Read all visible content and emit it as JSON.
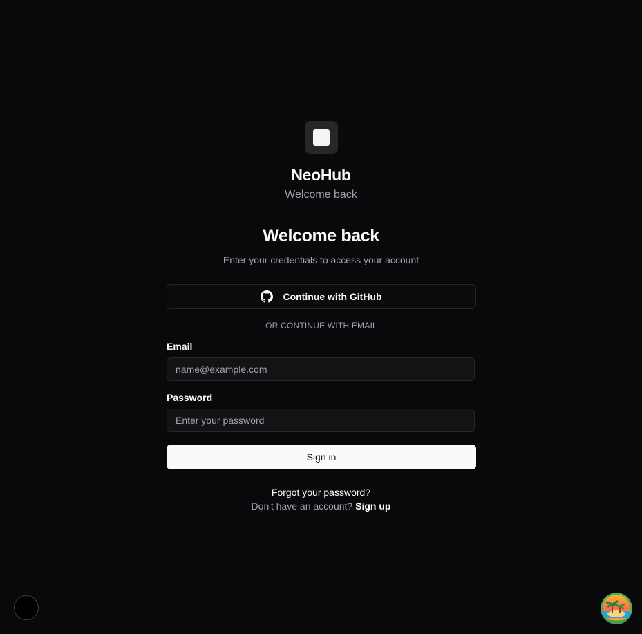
{
  "brand": {
    "name": "NeoHub",
    "tagline": "Welcome back",
    "logo_icon": "square-logo-icon"
  },
  "form": {
    "heading": "Welcome back",
    "subheading": "Enter your credentials to access your account",
    "github_button": {
      "label": "Continue with GitHub",
      "icon": "github-icon"
    },
    "divider_text": "OR CONTINUE WITH EMAIL",
    "email": {
      "label": "Email",
      "value": "",
      "placeholder": "name@example.com"
    },
    "password": {
      "label": "Password",
      "value": "",
      "placeholder": "Enter your password"
    },
    "signin_label": "Sign in",
    "forgot_label": "Forgot your password?",
    "signup_prompt": "Don't have an account?",
    "signup_label": "Sign up"
  },
  "colors": {
    "background": "#09090b",
    "primary_button": "#fafafa",
    "muted_text": "#a1a1aa",
    "border": "#27272a"
  }
}
